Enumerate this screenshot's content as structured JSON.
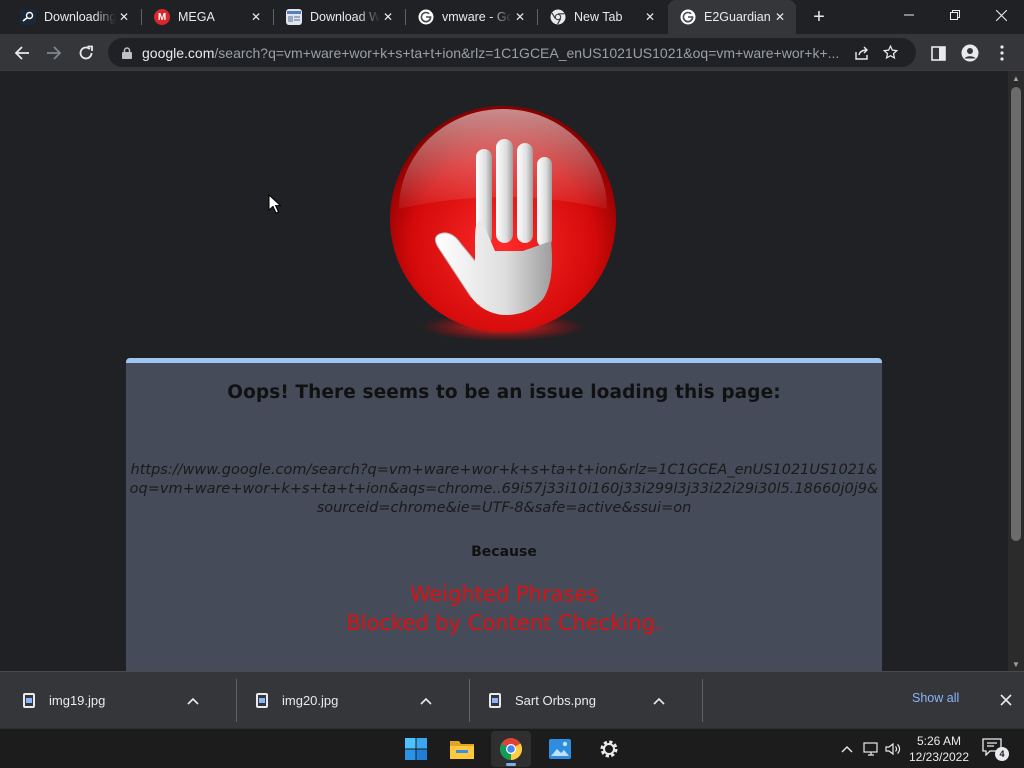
{
  "browser": {
    "tabs": [
      {
        "title": "Downloading",
        "favicon": "steam-like-icon",
        "favicon_color": "#1b2838",
        "active": false
      },
      {
        "title": "MEGA",
        "favicon": "mega-icon",
        "favicon_color": "#d9272e",
        "active": false
      },
      {
        "title": "Download W",
        "favicon": "page-thumbnail-icon",
        "favicon_color": "#5b7fb5",
        "active": false
      },
      {
        "title": "vmware - Go",
        "favicon": "google-icon",
        "favicon_color": "#ffffff",
        "active": false
      },
      {
        "title": "New Tab",
        "favicon": "chrome-icon",
        "favicon_color": "#ffffff",
        "active": false
      },
      {
        "title": "E2Guardian",
        "favicon": "google-icon",
        "favicon_color": "#ffffff",
        "active": true
      }
    ],
    "address_bar": {
      "host": "google.com",
      "path": "/search?q=vm+ware+wor+k+s+ta+t+ion&rlz=1C1GCEA_enUS1021US1021&oq=vm+ware+wor+k+..."
    }
  },
  "page": {
    "heading": "Oops! There seems to be an issue loading this page:",
    "blocked_url": "https://www.google.com/search?q=vm+ware+wor+k+s+ta+t+ion&rlz=1C1GCEA_enUS1021US1021&oq=vm+ware+wor+k+s+ta+t+ion&aqs=chrome..69i57j33i10i160j33i299l3j33i22i29i30l5.18660j0j9&sourceid=chrome&ie=UTF-8&safe=active&ssui=on",
    "because_label": "Because",
    "reason_line1": "Weighted Phrases",
    "reason_line2": "Blocked by Content Checking."
  },
  "downloads": {
    "items": [
      {
        "name": "img19.jpg"
      },
      {
        "name": "img20.jpg"
      },
      {
        "name": "Sart Orbs.png"
      }
    ],
    "show_all": "Show all"
  },
  "taskbar": {
    "apps": [
      "windows-start-icon",
      "file-explorer-icon",
      "chrome-icon",
      "photos-icon",
      "settings-icon"
    ],
    "clock_time": "5:26 AM",
    "clock_date": "12/23/2022",
    "notification_count": "4"
  },
  "colors": {
    "accent_blue": "#8ab4f8",
    "block_red": "#dd1111",
    "panel_bg": "#464b59",
    "panel_border": "#9fc5f0"
  }
}
